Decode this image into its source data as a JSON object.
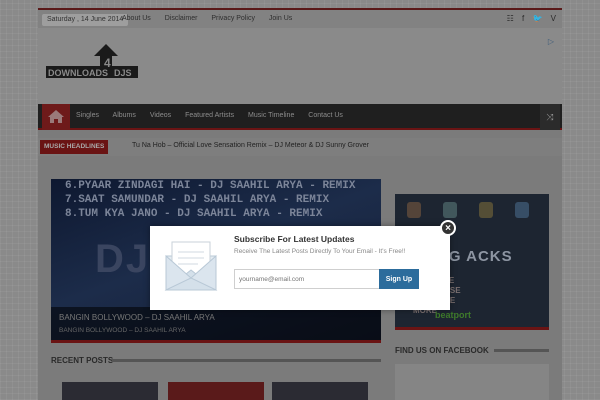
{
  "topbar": {
    "date": "Saturday , 14 June 2014",
    "nav": [
      "About Us",
      "Disclaimer",
      "Privacy Policy",
      "Join Us"
    ],
    "social_icons": [
      "rss-icon",
      "facebook-icon",
      "twitter-icon",
      "vimeo-icon"
    ]
  },
  "header": {
    "logo_text": "DOWNLOADS",
    "logo_number": "4",
    "logo_suffix": "DJS"
  },
  "mainnav": {
    "items": [
      "Singles",
      "Albums",
      "Videos",
      "Featured Artists",
      "Music Timeline",
      "Contact Us"
    ]
  },
  "headlines": {
    "label": "MUSIC HEADLINES",
    "text": "Tu Na Hob – Official Love Sensation Remix – DJ Meteor & DJ Sunny Grover"
  },
  "slider": {
    "lines": [
      "6.PYAAR ZINDAGI HAI - DJ SAAHIL ARYA - REMIX",
      "7.SAAT SAMUNDAR - DJ SAAHIL ARYA - REMIX",
      "8.TUM KYA JANO  - DJ SAAHIL ARYA - REMIX"
    ],
    "overlay_text": "DJ S",
    "caption_title": "BANGIN BOLLYWOOD – DJ SAAHIL ARYA",
    "caption_sub": "BANGIN BOLLYWOOD – DJ SAAHIL ARYA"
  },
  "sidebar_ad": {
    "big": "ENING ACKS",
    "small_lines": [
      "EP HOUSE",
      "TRO HOUSE",
      "CH HOUSE",
      "MORE"
    ],
    "brand": "beatport"
  },
  "sections": {
    "recent_posts": "RECENT POSTS",
    "facebook": "FIND US ON FACEBOOK"
  },
  "popup": {
    "title": "Subscribe For Latest Updates",
    "description": "Receive The Latest Posts Directly To Your Email - It's Free!!",
    "email_placeholder": "yourname@email.com",
    "signup_label": "Sign Up",
    "close_label": "×"
  },
  "colors": {
    "accent": "#c82a2a",
    "button": "#2c6c9c"
  }
}
